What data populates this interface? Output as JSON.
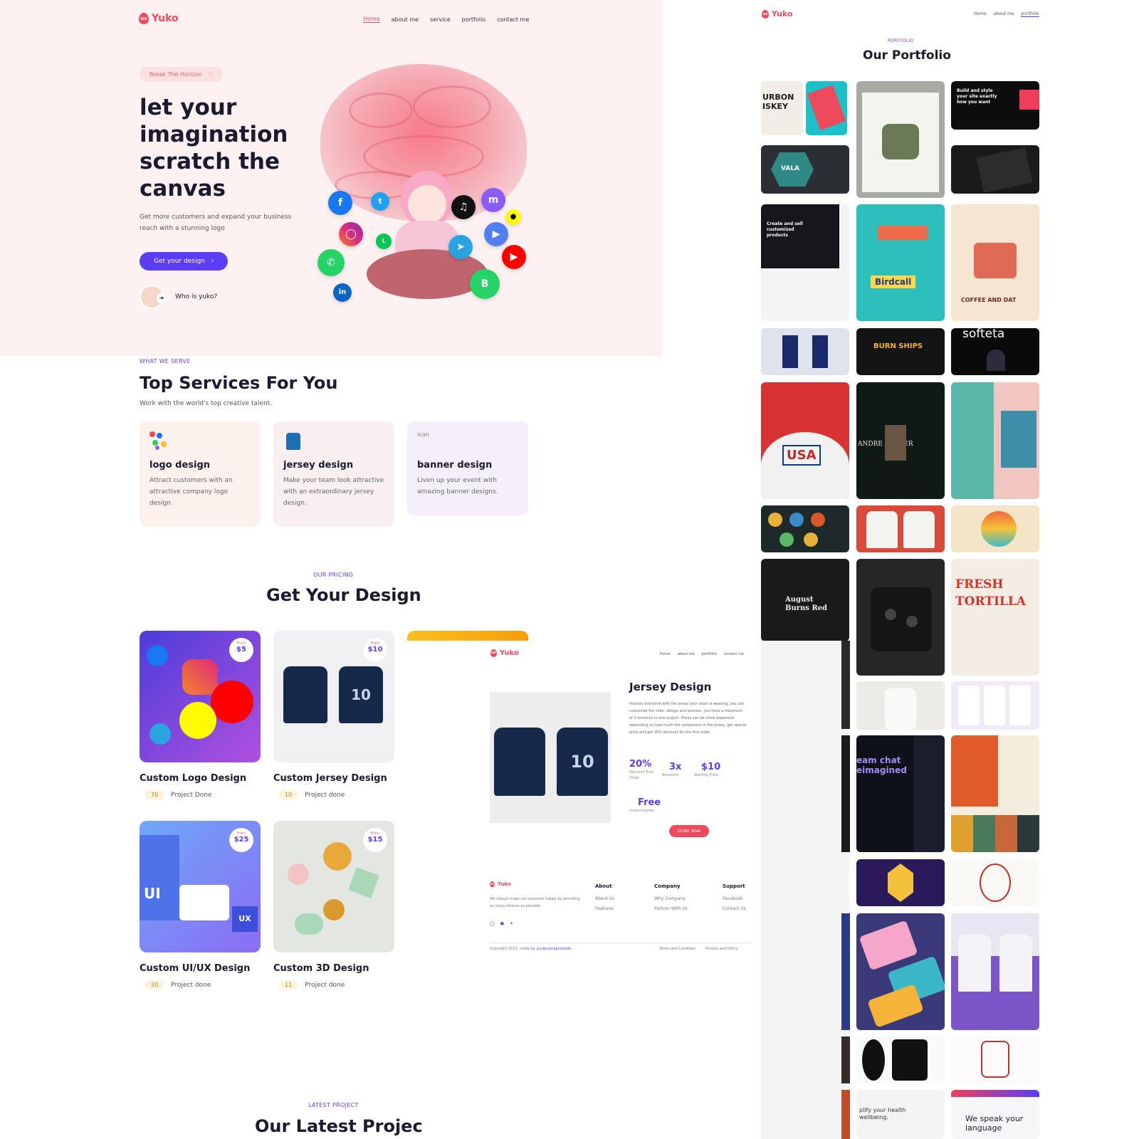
{
  "main": {
    "brand": "Yuko",
    "nav": [
      "Home",
      "about me",
      "service",
      "portfolio",
      "contact me"
    ],
    "hero": {
      "pill": "Break The Horizon",
      "title": "let your imagination scratch the canvas",
      "subtitle": "Get more customers and expand your business reach with a stunning logo",
      "cta": "Get your design",
      "who": "Who is yuko?"
    },
    "services": {
      "kicker": "WHAT WE SERVE",
      "title": "Top Services For You",
      "subtitle": "Work with the world's top creative talent.",
      "cards": [
        {
          "title": "logo design",
          "desc": "Attract customers with an attractive company logo design."
        },
        {
          "title": "jersey design",
          "desc": "Make your team look attractive with an extraordinary jersey design."
        },
        {
          "title": "banner design",
          "desc": "Liven up your event with amazing banner designs.",
          "icon_alt": "icon"
        }
      ]
    },
    "pricing": {
      "kicker": "OUR PRICING",
      "title": "Get Your Design",
      "from_label": "From",
      "cards": [
        {
          "name": "Custom Logo Design",
          "price": "$5",
          "count": "70",
          "meta": "Project Done"
        },
        {
          "name": "Custom Jersey Design",
          "price": "$10",
          "count": "10",
          "meta": "Project done"
        },
        {
          "name": "Custom UI/UX Design",
          "price": "$25",
          "count": "20",
          "meta": "Project done"
        },
        {
          "name": "Custom 3D Design",
          "price": "$15",
          "count": "11",
          "meta": "Project done"
        }
      ]
    },
    "latest": {
      "kicker": "LATEST PROJECT",
      "title": "Our Latest Projec"
    }
  },
  "detail": {
    "brand": "Yuko",
    "nav": [
      "Home",
      "about me",
      "portfolio",
      "contact me"
    ],
    "title": "Jersey Design",
    "desc": "Impress everyone with the jersey your team is wearing, you can customize the color, design and sponsor, you have a maximum of 3 revisions in one project. Prices can be more expensive depending on how much the component in the jersey, get special price and get 20% discount for the first order.",
    "stats": [
      {
        "value": "20%",
        "label": "Discount First Order"
      },
      {
        "value": "3x",
        "label": "Revisions"
      },
      {
        "value": "$10",
        "label": "Starting Price"
      },
      {
        "value": "Free",
        "label": "customization"
      }
    ],
    "order": "Order Now",
    "footer": {
      "about_text": "We always make our customer happy by providing as many choices as possible",
      "cols": [
        {
          "head": "About",
          "items": [
            "About Us",
            "Features"
          ]
        },
        {
          "head": "Company",
          "items": [
            "Why Company",
            "Partner With Us"
          ]
        },
        {
          "head": "Support",
          "items": [
            "Facebook",
            "Contact Us"
          ]
        }
      ],
      "copyright": "Copyright 2023, made by",
      "copyright_link": "yuniputeraprocolda",
      "terms": "Terms and Condition",
      "privacy": "Privacy and Policy"
    }
  },
  "portfolio": {
    "brand": "Yuko",
    "nav": [
      "Home",
      "about me",
      "portfolio"
    ],
    "kicker": "PORTFOLIO",
    "title": "Our Portfolio",
    "tile_texts": {
      "whisky": "URBON ISKEY",
      "webflow": "Build and style your site exactly how you want",
      "vala": "VALA",
      "ecom": "Create and sell customized products",
      "birdcall": "Birdcall",
      "coffee": "COFFEE AND DAT",
      "burnships": "BURN SHIPS",
      "softeta": "softeta",
      "usa": "USA",
      "barber": "ANDRE BARBER",
      "august": "August Burns Red",
      "fresh": "FRESH TORTILLA",
      "chat": "eam chat eimagined",
      "ui": "UI",
      "ux": "UX",
      "speak": "We speak your language",
      "health": "plify your health wellbeing."
    }
  },
  "colors": {
    "accent": "#5b3df5",
    "brand": "#ef4a5c",
    "hero_bg": "#fdf1f1"
  }
}
